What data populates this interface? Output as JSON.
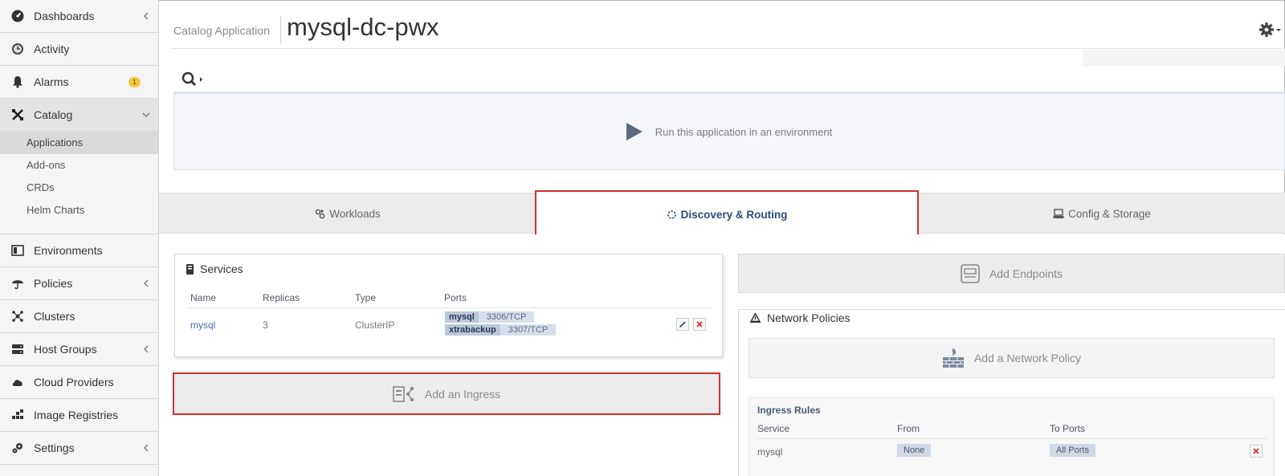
{
  "sidebar": {
    "items": [
      {
        "label": "Dashboards",
        "icon": "dashboard-icon"
      },
      {
        "label": "Activity",
        "icon": "activity-icon"
      },
      {
        "label": "Alarms",
        "icon": "bell-icon",
        "badge": "1"
      },
      {
        "label": "Catalog",
        "icon": "catalog-icon"
      },
      {
        "label": "Environments",
        "icon": "environments-icon"
      },
      {
        "label": "Policies",
        "icon": "umbrella-icon"
      },
      {
        "label": "Clusters",
        "icon": "clusters-icon"
      },
      {
        "label": "Host Groups",
        "icon": "server-icon"
      },
      {
        "label": "Cloud Providers",
        "icon": "cloud-icon"
      },
      {
        "label": "Image Registries",
        "icon": "registry-icon"
      },
      {
        "label": "Settings",
        "icon": "settings-icon"
      }
    ],
    "catalog_sub": [
      "Applications",
      "Add-ons",
      "CRDs",
      "Helm Charts"
    ]
  },
  "header": {
    "breadcrumb": "Catalog Application",
    "title": "mysql-dc-pwx"
  },
  "run_panel": {
    "text": "Run this application in an environment"
  },
  "tabs": [
    "Workloads",
    "Discovery & Routing",
    "Config & Storage"
  ],
  "services": {
    "title": "Services",
    "columns": [
      "Name",
      "Replicas",
      "Type",
      "Ports"
    ],
    "rows": [
      {
        "name": "mysql",
        "replicas": "3",
        "type": "ClusterIP",
        "ports": [
          {
            "name": "mysql",
            "value": "3306/TCP"
          },
          {
            "name": "xtrabackup",
            "value": "3307/TCP"
          }
        ]
      }
    ]
  },
  "add_ingress": "Add an Ingress",
  "add_endpoints": "Add Endpoints",
  "network_policies": {
    "title": "Network Policies",
    "add_label": "Add a Network Policy",
    "ingress_rules": {
      "title": "Ingress Rules",
      "columns": [
        "Service",
        "From",
        "To Ports"
      ],
      "rows": [
        {
          "service": "mysql",
          "from": "None",
          "to_ports": "All Ports"
        }
      ]
    }
  },
  "colors": {
    "accent": "#2d4a7a",
    "highlight": "#d32f2f",
    "badge": "#f5c842"
  }
}
